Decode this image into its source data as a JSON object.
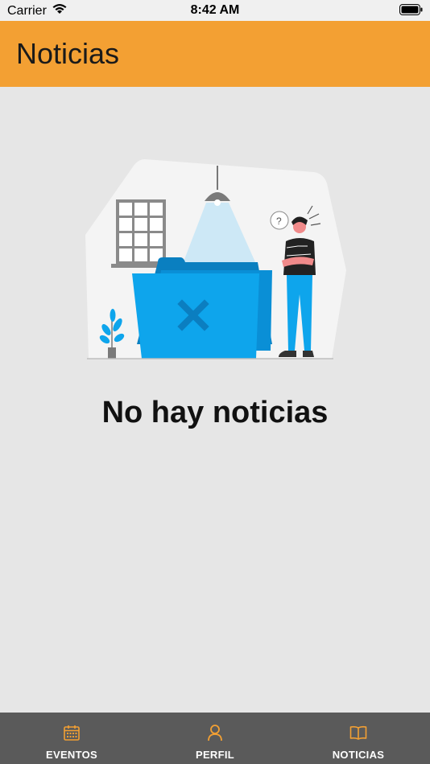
{
  "status_bar": {
    "carrier": "Carrier",
    "time": "8:42 AM"
  },
  "header": {
    "title": "Noticias"
  },
  "main": {
    "empty_message": "No hay noticias",
    "illustration": "empty-folder-illustration"
  },
  "tabs": [
    {
      "label": "EVENTOS",
      "icon": "calendar-icon"
    },
    {
      "label": "PERFIL",
      "icon": "person-icon"
    },
    {
      "label": "NOTICIAS",
      "icon": "book-icon",
      "active": true
    }
  ],
  "colors": {
    "accent": "#f3a033",
    "tab_bar": "#5a5a5a",
    "background": "#e6e6e6",
    "folder_blue": "#0ea5ec"
  }
}
